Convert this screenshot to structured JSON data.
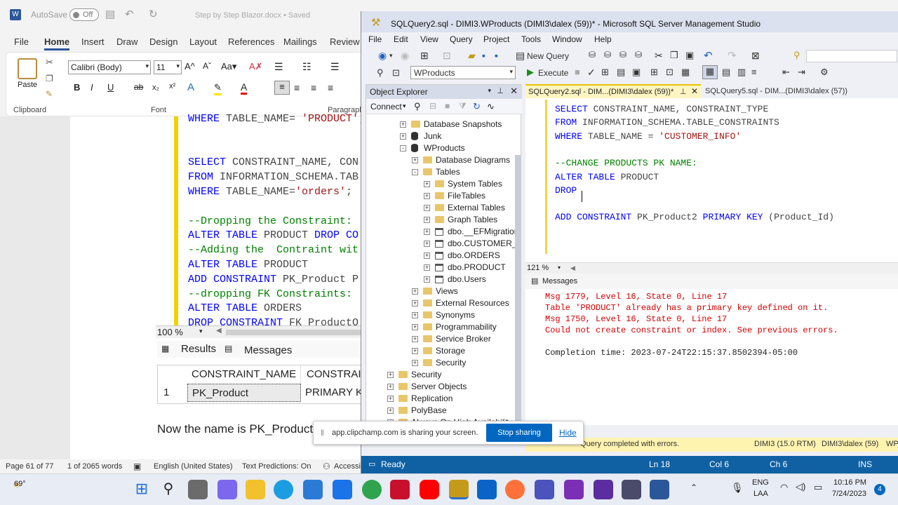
{
  "word": {
    "title": "Step by Step Blazor.docx • Saved",
    "autosave_label": "AutoSave",
    "autosave_state": "Off",
    "menu": [
      "File",
      "Home",
      "Insert",
      "Draw",
      "Design",
      "Layout",
      "References",
      "Mailings",
      "Review"
    ],
    "font_name": "Calibri (Body)",
    "font_size": "11",
    "paste_label": "Paste",
    "clipboard_label": "Clipboard",
    "font_group_label": "Font",
    "paragraph_label": "Paragraph",
    "code_lines": [
      {
        "parts": [
          [
            "kw",
            "WHERE "
          ],
          [
            "gy",
            "TABLE_NAME= "
          ],
          [
            "str",
            "'PRODUCT';"
          ]
        ]
      },
      {
        "parts": []
      },
      {
        "parts": []
      },
      {
        "parts": [
          [
            "kw",
            "SELECT "
          ],
          [
            "gy",
            "CONSTRAINT_NAME, CON"
          ]
        ]
      },
      {
        "parts": [
          [
            "kw",
            "FROM "
          ],
          [
            "gy",
            "INFORMATION_SCHEMA.TAB"
          ]
        ]
      },
      {
        "parts": [
          [
            "kw",
            "WHERE "
          ],
          [
            "gy",
            "TABLE_NAME="
          ],
          [
            "str",
            "'orders'"
          ],
          [
            "gy",
            ";"
          ]
        ]
      },
      {
        "parts": []
      },
      {
        "parts": [
          [
            "cm",
            "--Dropping the Constraint:"
          ]
        ]
      },
      {
        "parts": [
          [
            "kw",
            "ALTER TABLE "
          ],
          [
            "gy",
            "PRODUCT "
          ],
          [
            "kw",
            "DROP CO"
          ]
        ]
      },
      {
        "parts": [
          [
            "cm",
            "--Adding the  Contraint wit"
          ]
        ]
      },
      {
        "parts": [
          [
            "kw",
            "ALTER TABLE "
          ],
          [
            "gy",
            "PRODUCT"
          ]
        ]
      },
      {
        "parts": [
          [
            "kw",
            "ADD CONSTRAINT "
          ],
          [
            "gy",
            "PK_Product P"
          ]
        ]
      },
      {
        "parts": [
          [
            "cm",
            "--dropping FK Constraints:"
          ]
        ]
      },
      {
        "parts": [
          [
            "kw",
            "ALTER TABLE "
          ],
          [
            "gy",
            "ORDERS"
          ]
        ]
      },
      {
        "parts": [
          [
            "kw",
            "DROP CONSTRAINT "
          ],
          [
            "gy",
            "FK_ProductO"
          ]
        ]
      }
    ],
    "zoom": "100 %",
    "results_tab": "Results",
    "messages_tab": "Messages",
    "grid_headers": [
      "CONSTRAINT_NAME",
      "CONSTRAIN"
    ],
    "grid_row": {
      "num": "1",
      "name": "PK_Product",
      "type": "PRIMARY K"
    },
    "body_text": "Now the name is PK_Product",
    "status": {
      "page": "Page 61 of 77",
      "words": "1 of 2065 words",
      "lang": "English (United States)",
      "pred": "Text Predictions: On",
      "access": "Accessib"
    }
  },
  "ssms": {
    "title": "SQLQuery2.sql - DIMI3.WProducts (DIMI3\\dalex (59))* - Microsoft SQL Server Management Studio",
    "menu": [
      "File",
      "Edit",
      "View",
      "Query",
      "Project",
      "Tools",
      "Window",
      "Help"
    ],
    "new_query": "New Query",
    "database": "WProducts",
    "execute": "Execute",
    "oe_title": "Object Explorer",
    "oe_connect": "Connect",
    "tree": [
      {
        "label": "Database Snapshots",
        "indent": 0,
        "icon": "folder",
        "exp": "+"
      },
      {
        "label": "Junk",
        "indent": 0,
        "icon": "db",
        "exp": "+"
      },
      {
        "label": "WProducts",
        "indent": 0,
        "icon": "db",
        "exp": "-"
      },
      {
        "label": "Database Diagrams",
        "indent": 1,
        "icon": "folder",
        "exp": "+"
      },
      {
        "label": "Tables",
        "indent": 1,
        "icon": "folder",
        "exp": "-"
      },
      {
        "label": "System Tables",
        "indent": 2,
        "icon": "folder",
        "exp": "+"
      },
      {
        "label": "FileTables",
        "indent": 2,
        "icon": "folder",
        "exp": "+"
      },
      {
        "label": "External Tables",
        "indent": 2,
        "icon": "folder",
        "exp": "+"
      },
      {
        "label": "Graph Tables",
        "indent": 2,
        "icon": "folder",
        "exp": "+"
      },
      {
        "label": "dbo.__EFMigratior",
        "indent": 2,
        "icon": "table",
        "exp": "+"
      },
      {
        "label": "dbo.CUSTOMER_II",
        "indent": 2,
        "icon": "table",
        "exp": "+"
      },
      {
        "label": "dbo.ORDERS",
        "indent": 2,
        "icon": "table",
        "exp": "+"
      },
      {
        "label": "dbo.PRODUCT",
        "indent": 2,
        "icon": "table",
        "exp": "+"
      },
      {
        "label": "dbo.Users",
        "indent": 2,
        "icon": "table",
        "exp": "+"
      },
      {
        "label": "Views",
        "indent": 1,
        "icon": "folder",
        "exp": "+"
      },
      {
        "label": "External Resources",
        "indent": 1,
        "icon": "folder",
        "exp": "+"
      },
      {
        "label": "Synonyms",
        "indent": 1,
        "icon": "folder",
        "exp": "+"
      },
      {
        "label": "Programmability",
        "indent": 1,
        "icon": "folder",
        "exp": "+"
      },
      {
        "label": "Service Broker",
        "indent": 1,
        "icon": "folder",
        "exp": "+"
      },
      {
        "label": "Storage",
        "indent": 1,
        "icon": "folder",
        "exp": "+"
      },
      {
        "label": "Security",
        "indent": 1,
        "icon": "folder",
        "exp": "+"
      },
      {
        "label": "Security",
        "indent": -1,
        "icon": "folder",
        "exp": "+"
      },
      {
        "label": "Server Objects",
        "indent": -1,
        "icon": "folder",
        "exp": "+"
      },
      {
        "label": "Replication",
        "indent": -1,
        "icon": "folder",
        "exp": "+"
      },
      {
        "label": "PolyBase",
        "indent": -1,
        "icon": "folder",
        "exp": "+"
      },
      {
        "label": "Always On High Availability",
        "indent": -1,
        "icon": "folder",
        "exp": "+"
      }
    ],
    "tab_active": "SQLQuery2.sql - DIM...(DIMI3\\dalex (59))*",
    "tab_other": "SQLQuery5.sql - DIM...(DIMI3\\dalex (57))",
    "editor_lines": [
      {
        "parts": [
          [
            "kw",
            "SELECT "
          ],
          [
            "gy",
            "CONSTRAINT_NAME, CONSTRAINT_TYPE"
          ]
        ]
      },
      {
        "parts": [
          [
            "kw",
            "FROM "
          ],
          [
            "gy",
            "INFORMATION_SCHEMA.TABLE_CONSTRAINTS"
          ]
        ]
      },
      {
        "parts": [
          [
            "kw",
            "WHERE "
          ],
          [
            "gy",
            "TABLE_NAME = "
          ],
          [
            "str",
            "'CUSTOMER_INFO'"
          ]
        ]
      },
      {
        "parts": []
      },
      {
        "parts": [
          [
            "cm",
            "--CHANGE PRODUCTS PK NAME:"
          ]
        ]
      },
      {
        "parts": [
          [
            "kw",
            "ALTER TABLE "
          ],
          [
            "gy",
            "PRODUCT"
          ]
        ]
      },
      {
        "parts": [
          [
            "kw",
            "DROP "
          ]
        ]
      },
      {
        "parts": []
      },
      {
        "parts": [
          [
            "kw",
            "ADD CONSTRAINT "
          ],
          [
            "gy",
            "PK_Product2 "
          ],
          [
            "kw",
            "PRIMARY KEY "
          ],
          [
            "gy",
            "(Product_Id)"
          ]
        ]
      }
    ],
    "editor_zoom": "121 %",
    "messages_title": "Messages",
    "messages": [
      "Msg 1779, Level 16, State 0, Line 17",
      "Table 'PRODUCT' already has a primary key defined on it.",
      "Msg 1750, Level 16, State 0, Line 17",
      "Could not create constraint or index. See previous errors.",
      "",
      "Completion time: 2023-07-24T22:15:37.8502394-05:00"
    ],
    "query_status": "Query completed with errors.",
    "server": "DIMI3 (15.0 RTM)",
    "user": "DIMI3\\dalex (59)",
    "db_short": "WP",
    "status_ready": "Ready",
    "ln": "Ln 18",
    "col": "Col 6",
    "ch": "Ch 6",
    "ins": "INS"
  },
  "share": {
    "text": "app.clipchamp.com is sharing your screen.",
    "stop": "Stop sharing",
    "hide": "Hide"
  },
  "taskbar": {
    "temp": "69°",
    "lang1": "ENG",
    "lang2": "LAA",
    "time": "10:16 PM",
    "date": "7/24/2023",
    "badge": "4"
  }
}
